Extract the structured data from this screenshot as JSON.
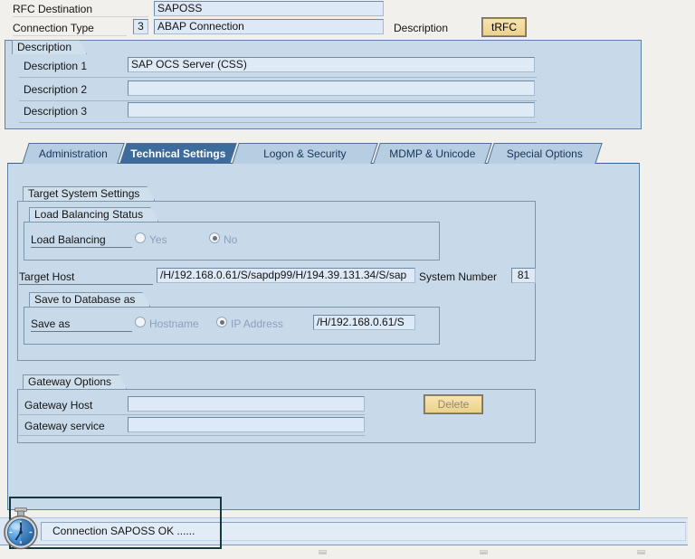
{
  "header": {
    "rfc_destination_label": "RFC Destination",
    "rfc_destination_value": "SAPOSS",
    "connection_type_label": "Connection Type",
    "connection_type_code": "3",
    "connection_type_name": "ABAP Connection",
    "description_label": "Description",
    "trfc_button": "tRFC"
  },
  "description_group": {
    "title": "Description",
    "rows": [
      {
        "label": "Description 1",
        "value": "SAP OCS Server (CSS)"
      },
      {
        "label": "Description 2",
        "value": ""
      },
      {
        "label": "Description 3",
        "value": ""
      }
    ]
  },
  "tabs": [
    {
      "label": "Administration",
      "active": false
    },
    {
      "label": "Technical Settings",
      "active": true
    },
    {
      "label": "Logon & Security",
      "active": false
    },
    {
      "label": "MDMP & Unicode",
      "active": false
    },
    {
      "label": "Special Options",
      "active": false
    }
  ],
  "technical": {
    "target_system_settings_title": "Target System Settings",
    "load_balancing": {
      "title": "Load Balancing Status",
      "label": "Load Balancing",
      "options": [
        {
          "label": "Yes",
          "selected": false
        },
        {
          "label": "No",
          "selected": true
        }
      ]
    },
    "target_host": {
      "label": "Target Host",
      "value": "/H/192.168.0.61/S/sapdp99/H/194.39.131.34/S/sap"
    },
    "system_number": {
      "label": "System Number",
      "value": "81"
    },
    "save_to_database": {
      "title": "Save to Database as",
      "label": "Save as",
      "options": [
        {
          "label": "Hostname",
          "selected": false
        },
        {
          "label": "IP Address",
          "selected": true
        }
      ],
      "value": "/H/192.168.0.61/S"
    }
  },
  "gateway": {
    "title": "Gateway Options",
    "rows": [
      {
        "label": "Gateway Host",
        "value": ""
      },
      {
        "label": "Gateway service",
        "value": ""
      }
    ],
    "delete_button": "Delete"
  },
  "statusbar": {
    "message": "Connection SAPOSS OK ......",
    "icon": "stopwatch-icon"
  },
  "colors": {
    "active_tab": "#3d6b9b",
    "panel_blue": "#c8daea",
    "field_blue": "#dde9f6",
    "button_tan": "#f0d9a0",
    "annotation_border": "#16393a",
    "stopwatch_blue": "#4e9adc"
  }
}
